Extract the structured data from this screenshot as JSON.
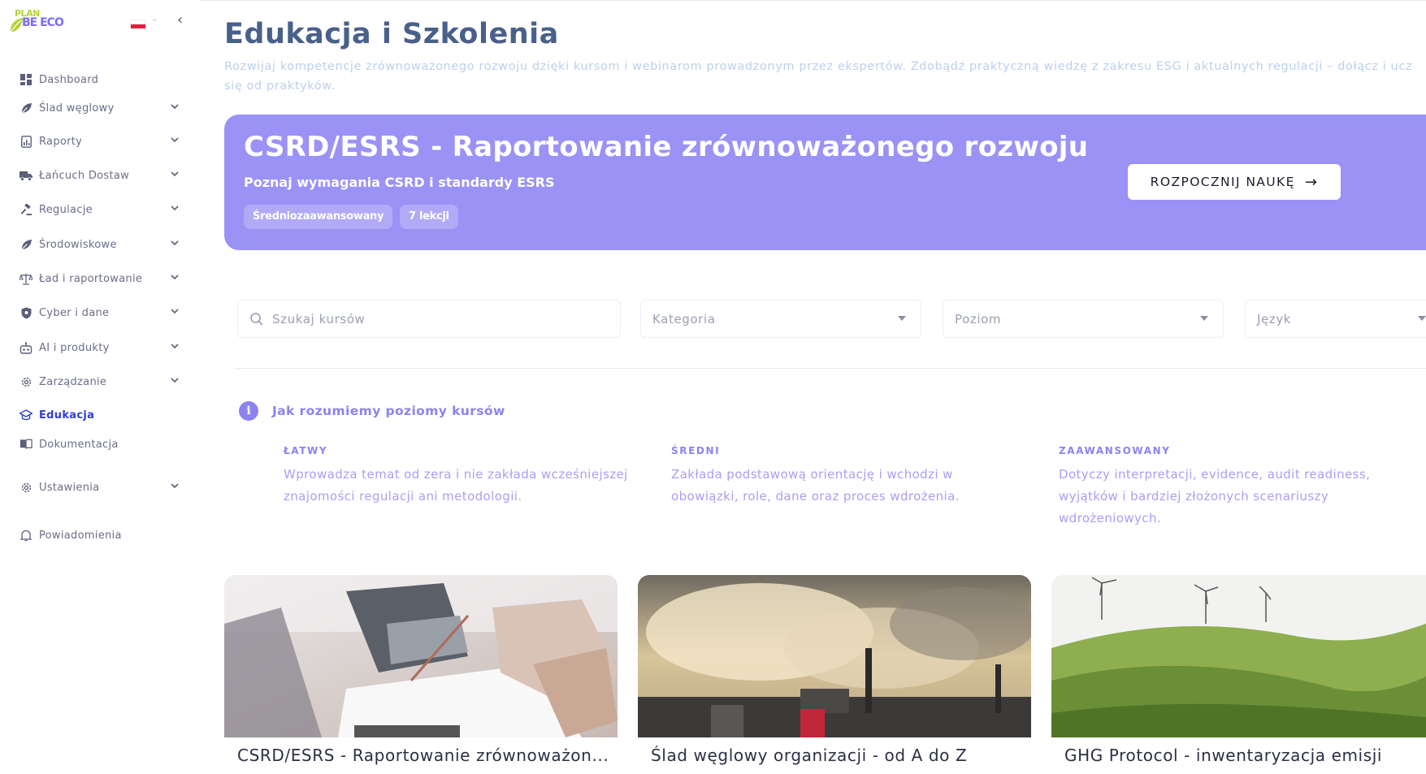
{
  "sidebar": {
    "brand_top": "PLAN",
    "brand_bottom": "BE ECO",
    "items": [
      {
        "label": "Dashboard"
      },
      {
        "label": "Ślad węglowy"
      },
      {
        "label": "Raporty"
      },
      {
        "label": "Łańcuch Dostaw"
      },
      {
        "label": "Regulacje"
      },
      {
        "label": "Środowiskowe"
      },
      {
        "label": "Ład i raportowanie"
      },
      {
        "label": "Cyber i dane"
      },
      {
        "label": "AI i produkty"
      },
      {
        "label": "Zarządzanie"
      },
      {
        "label": "Edukacja"
      },
      {
        "label": "Dokumentacja"
      },
      {
        "label": "Ustawienia"
      },
      {
        "label": "Powiadomienia"
      }
    ]
  },
  "main": {
    "title": "Edukacja i Szkolenia",
    "description": "Rozwijaj kompetencje zrównoważonego rozwoju dzięki kursom i webinarom prowadzonym przez ekspertów. Zdobądź praktyczną wiedzę z zakresu ESG i aktualnych regulacji – dołącz i ucz się od praktyków."
  },
  "hero": {
    "title": "CSRD/ESRS - Raportowanie zrównoważonego rozwoju",
    "subtitle": "Poznaj wymagania CSRD i standardy ESRS",
    "badge_level": "Średniozaawansowany",
    "badge_lessons": "7 lekcji",
    "button_label": "ROZPOCZNIJ NAUKĘ",
    "color": "#9b92f5"
  },
  "filters": {
    "search_placeholder": "Szukaj kursów",
    "category": "Kategoria",
    "level": "Poziom",
    "language": "Język"
  },
  "levels_info": {
    "title": "Jak rozumiemy poziomy kursów",
    "levels": [
      {
        "name": "ŁATWY",
        "text": "Wprowadza temat od zera i nie zakłada wcześniejszej znajomości regulacji ani metodologii."
      },
      {
        "name": "ŚREDNI",
        "text": "Zakłada podstawową orientację i wchodzi w obowiązki, role, dane oraz proces wdrożenia."
      },
      {
        "name": "ZAAWANSOWANY",
        "text": "Dotyczy interpretacji, evidence, audit readiness, wyjątków i bardziej złożonych scenariuszy wdrożeniowych."
      }
    ]
  },
  "courses": [
    {
      "title": "CSRD/ESRS - Raportowanie zrównoważon..."
    },
    {
      "title": "Ślad węglowy organizacji - od A do Z"
    },
    {
      "title": "GHG Protocol - inwentaryzacja emisji"
    }
  ]
}
